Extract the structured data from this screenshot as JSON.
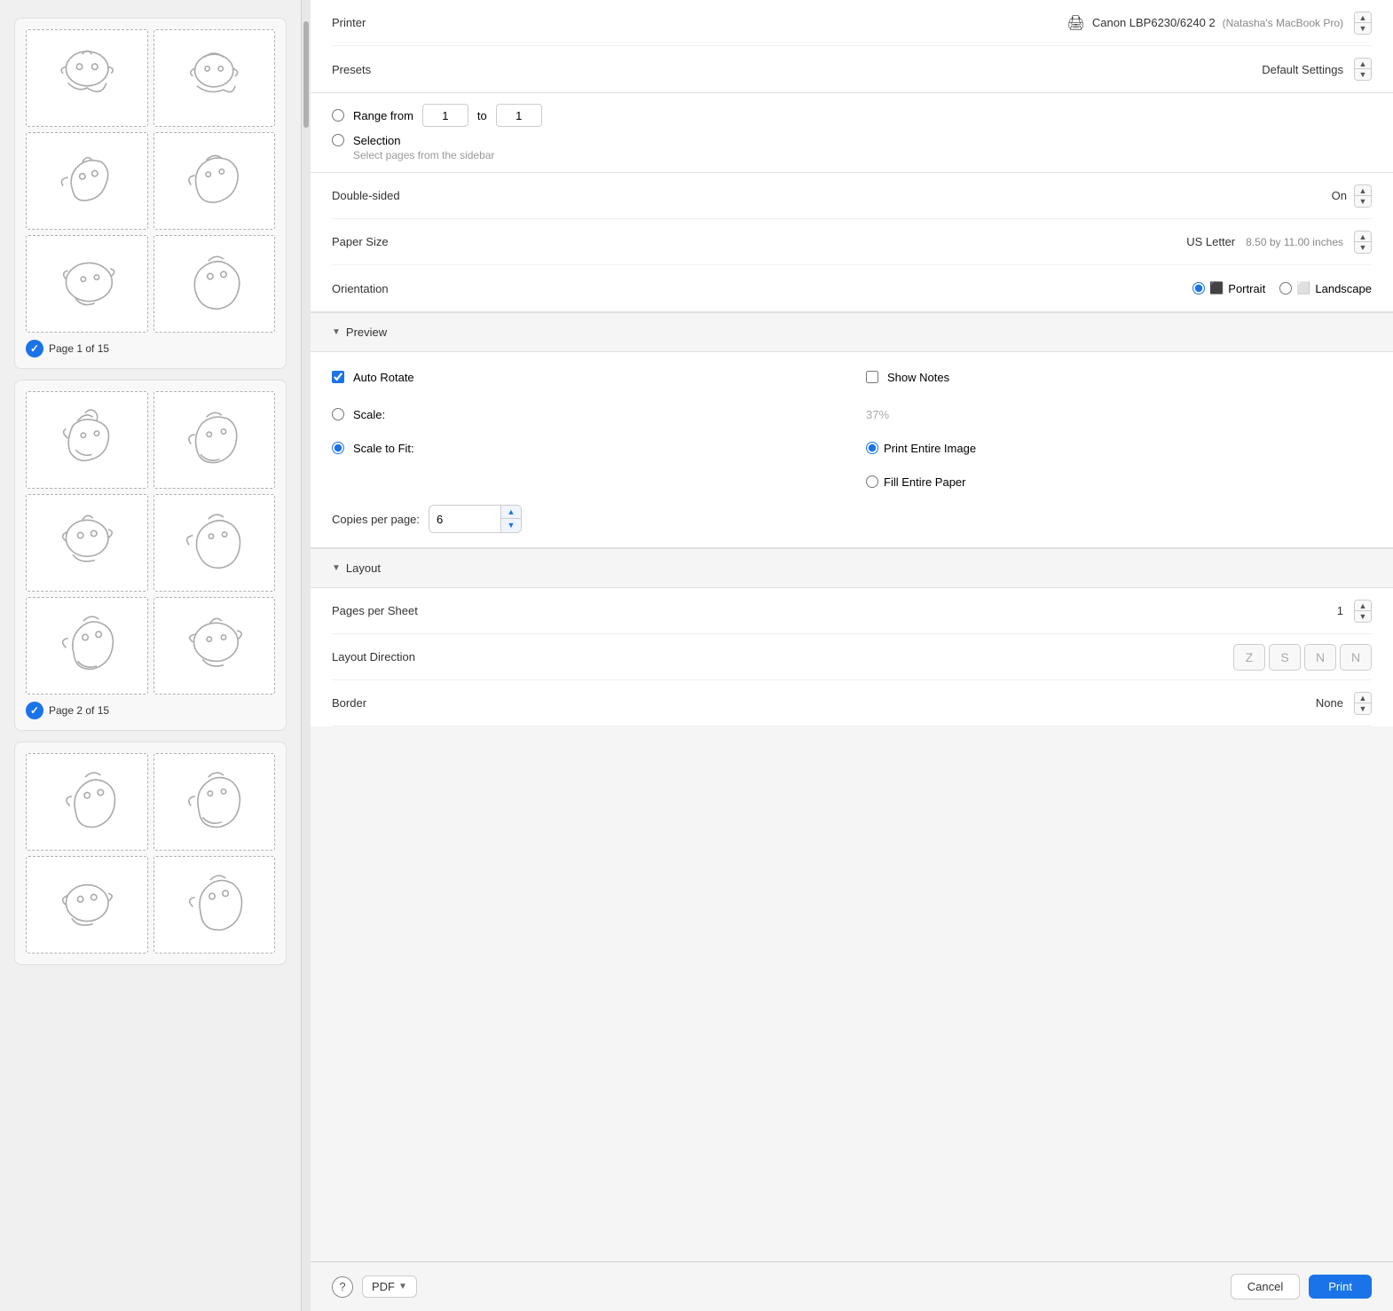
{
  "sidebar": {
    "scrollbar": "vertical",
    "page_groups": [
      {
        "id": "group1",
        "label": "Page 1 of 15",
        "checked": true,
        "thumbnails": 6
      },
      {
        "id": "group2",
        "label": "Page 2 of 15",
        "checked": true,
        "thumbnails": 6
      },
      {
        "id": "group3",
        "label": "",
        "checked": false,
        "thumbnails": 4
      }
    ]
  },
  "settings": {
    "printer": {
      "label": "Printer",
      "icon": "🖨",
      "name": "Canon LBP6230/6240 2",
      "sub": "(Natasha's MacBook Pro)"
    },
    "presets": {
      "label": "Presets",
      "value": "Default Settings"
    },
    "range": {
      "label_from": "Range from",
      "from_value": "1",
      "to_label": "to",
      "to_value": "1"
    },
    "selection": {
      "label": "Selection",
      "sub": "Select pages from the sidebar"
    },
    "double_sided": {
      "label": "Double-sided",
      "value": "On"
    },
    "paper_size": {
      "label": "Paper Size",
      "value": "US Letter",
      "detail": "8.50 by 11.00 inches"
    },
    "orientation": {
      "label": "Orientation",
      "portrait": "Portrait",
      "landscape": "Landscape",
      "selected": "portrait"
    }
  },
  "preview": {
    "section_label": "Preview",
    "auto_rotate": {
      "label": "Auto Rotate",
      "checked": true
    },
    "show_notes": {
      "label": "Show Notes",
      "checked": false
    },
    "scale": {
      "label": "Scale:",
      "value": "37%",
      "selected": false
    },
    "scale_to_fit": {
      "label": "Scale to Fit:",
      "selected": true
    },
    "print_entire_image": {
      "label": "Print Entire Image",
      "selected": true
    },
    "fill_entire_paper": {
      "label": "Fill Entire Paper",
      "selected": false
    },
    "copies_per_page": {
      "label": "Copies per page:",
      "value": "6"
    }
  },
  "layout": {
    "section_label": "Layout",
    "pages_per_sheet": {
      "label": "Pages per Sheet",
      "value": "1"
    },
    "layout_direction": {
      "label": "Layout Direction",
      "directions": [
        "↙",
        "↘",
        "↗",
        "↖"
      ]
    },
    "border": {
      "label": "Border",
      "value": "None"
    }
  },
  "bottom_bar": {
    "help_label": "?",
    "pdf_label": "PDF",
    "cancel_label": "Cancel",
    "print_label": "Print"
  }
}
